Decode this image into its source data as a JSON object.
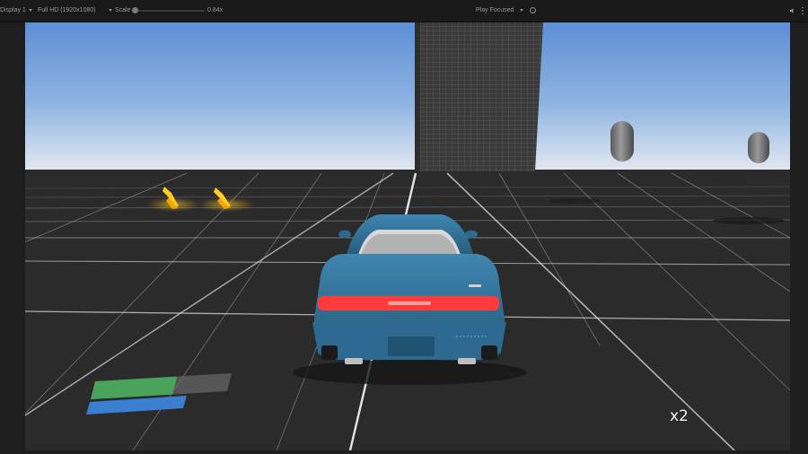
{
  "toolbar": {
    "display": "Display 1",
    "resolution": "Full HD (1920x1080)",
    "scale_label": "Scale",
    "scale_value": "0.84x",
    "play_mode": "Play Focused"
  },
  "hud": {
    "multiplier": "x2",
    "health_fraction": 0.6,
    "boost_fraction": 1.0,
    "health_color": "#4aa35a",
    "boost_color": "#3a7fd0"
  },
  "colors": {
    "sky_top": "#5d8fd6",
    "sky_horizon": "#dfe7ef",
    "ground": "#2b2b2b",
    "grid_line": "#d8d8d8",
    "car_body": "#2f6f95",
    "tail_light": "#ff3b3b",
    "pickup": "#ffcc22"
  },
  "icons": [
    "speaker-icon",
    "more-options-icon",
    "bug-icon",
    "dropdown-caret-icon"
  ]
}
